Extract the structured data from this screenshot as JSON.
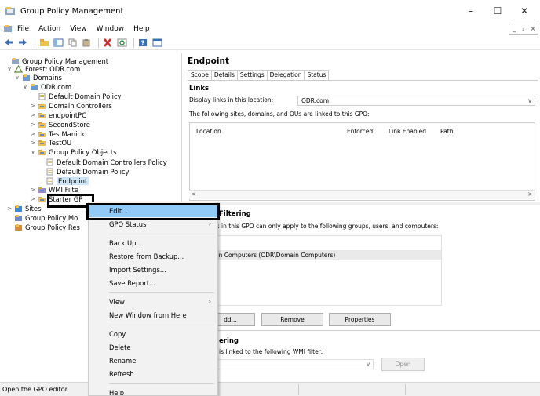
{
  "window": {
    "title": "Group Policy Management",
    "controls": [
      "–",
      "☐",
      "✕"
    ]
  },
  "menubar": {
    "items": [
      "File",
      "Action",
      "View",
      "Window",
      "Help"
    ],
    "mdi_controls": [
      "_",
      "ₐ",
      "×"
    ]
  },
  "toolbar": {
    "icons": [
      "back-icon",
      "forward-icon",
      "folder-up-icon",
      "show-tree-icon",
      "copy-icon",
      "paste-icon",
      "delete-icon",
      "refresh-icon",
      "help-icon",
      "console-icon"
    ]
  },
  "tree": {
    "items": [
      {
        "label": "Group Policy Management",
        "level": 0,
        "chev": "",
        "icon": "gpm-icon"
      },
      {
        "label": "Forest: ODR.com",
        "level": 1,
        "chev": "∨",
        "icon": "forest-icon"
      },
      {
        "label": "Domains",
        "level": 2,
        "chev": "∨",
        "icon": "domains-icon"
      },
      {
        "label": "ODR.com",
        "level": 3,
        "chev": "∨",
        "icon": "domain-icon"
      },
      {
        "label": "Default Domain Policy",
        "level": 4,
        "chev": "",
        "icon": "gpo-link-icon"
      },
      {
        "label": "Domain Controllers",
        "level": 4,
        "chev": ">",
        "icon": "ou-folder-icon"
      },
      {
        "label": "endpointPC",
        "level": 4,
        "chev": ">",
        "icon": "ou-folder-icon"
      },
      {
        "label": "SecondStore",
        "level": 4,
        "chev": ">",
        "icon": "ou-folder-icon"
      },
      {
        "label": "TestManick",
        "level": 4,
        "chev": ">",
        "icon": "ou-folder-icon"
      },
      {
        "label": "TestOU",
        "level": 4,
        "chev": ">",
        "icon": "ou-folder-icon"
      },
      {
        "label": "Group Policy Objects",
        "level": 4,
        "chev": "∨",
        "icon": "gpo-folder-icon"
      },
      {
        "label": "Default Domain Controllers Policy",
        "level": 5,
        "chev": "",
        "icon": "gpo-icon"
      },
      {
        "label": "Default Domain Policy",
        "level": 5,
        "chev": "",
        "icon": "gpo-icon"
      },
      {
        "label": "Endpoint",
        "level": 5,
        "chev": "",
        "icon": "gpo-icon"
      },
      {
        "label": "WMI Filte",
        "level": 4,
        "chev": ">",
        "icon": "wmi-folder-icon"
      },
      {
        "label": "Starter GP",
        "level": 4,
        "chev": ">",
        "icon": "starter-folder-icon"
      },
      {
        "label": "Sites",
        "level": 1,
        "chev": ">",
        "icon": "sites-icon"
      },
      {
        "label": "Group Policy Mo",
        "level": 1,
        "chev": "",
        "icon": "modeling-icon"
      },
      {
        "label": "Group Policy Res",
        "level": 1,
        "chev": "",
        "icon": "results-icon"
      }
    ]
  },
  "details": {
    "title": "Endpoint",
    "tabs": [
      "Scope",
      "Details",
      "Settings",
      "Delegation",
      "Status"
    ],
    "links": {
      "heading": "Links",
      "display_label": "Display links in this location:",
      "display_value": "ODR.com",
      "linked_text": "The following sites, domains, and OUs are linked to this GPO:",
      "columns": [
        "Location",
        "Enforced",
        "Link Enabled",
        "Path"
      ]
    },
    "security": {
      "heading": "Filtering",
      "text": "gs in this GPO can only apply to the following groups, users, and computers:",
      "entry": "ain Computers (ODR\\Domain Computers)",
      "buttons": [
        "dd...",
        "Remove",
        "Properties"
      ]
    },
    "wmi": {
      "heading": "ering",
      "text": "is linked to the following WMI filter:",
      "open": "Open"
    }
  },
  "context_menu": {
    "items": [
      {
        "label": "Edit...",
        "highlight": true
      },
      {
        "label": "GPO Status",
        "submenu": true
      },
      {
        "sep": true
      },
      {
        "label": "Back Up..."
      },
      {
        "label": "Restore from Backup..."
      },
      {
        "label": "Import Settings..."
      },
      {
        "label": "Save Report..."
      },
      {
        "sep": true
      },
      {
        "label": "View",
        "submenu": true
      },
      {
        "label": "New Window from Here"
      },
      {
        "sep": true
      },
      {
        "label": "Copy"
      },
      {
        "label": "Delete"
      },
      {
        "label": "Rename"
      },
      {
        "label": "Refresh"
      },
      {
        "sep": true
      },
      {
        "label": "Help"
      }
    ]
  },
  "status": {
    "text": "Open the GPO editor"
  }
}
